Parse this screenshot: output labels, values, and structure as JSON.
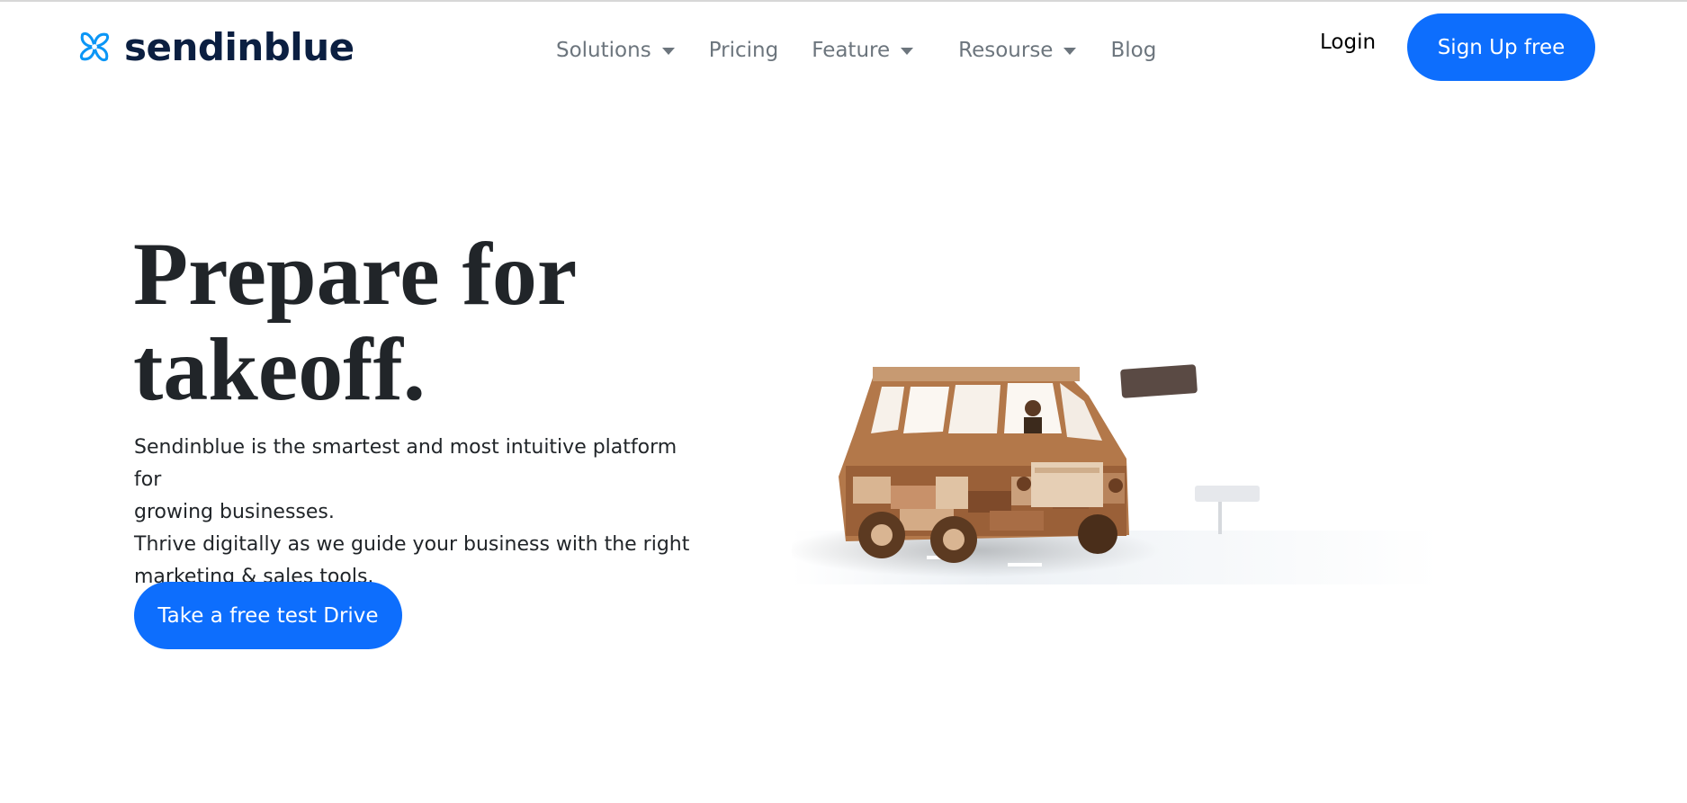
{
  "header": {
    "logo_text": "sendinblue",
    "nav": [
      {
        "label": "Solutions",
        "dropdown": true
      },
      {
        "label": "Pricing",
        "dropdown": false
      },
      {
        "label": "Feature",
        "dropdown": true
      },
      {
        "label": "Resourse",
        "dropdown": true
      },
      {
        "label": "Blog",
        "dropdown": false
      }
    ],
    "login_label": "Login",
    "signup_label": "Sign Up free"
  },
  "hero": {
    "title_line1": "Prepare for",
    "title_line2": "takeoff.",
    "desc_line1": "Sendinblue is the smartest and most intuitive platform for",
    "desc_line2": "growing businesses.",
    "desc_line3": "Thrive digitally as we guide your business with the right",
    "desc_line4": "marketing & sales tools.",
    "cta_label": "Take a free test Drive"
  },
  "colors": {
    "primary": "#0d6efd",
    "logo_text": "#0b1f41",
    "logo_icon": "#0b96f6",
    "nav_text": "#6c757d",
    "heading": "#212529"
  },
  "icons": {
    "logo": "sendinblue-swirl-icon",
    "dropdown": "caret-down-icon",
    "hero": "wooden-van-illustration"
  }
}
